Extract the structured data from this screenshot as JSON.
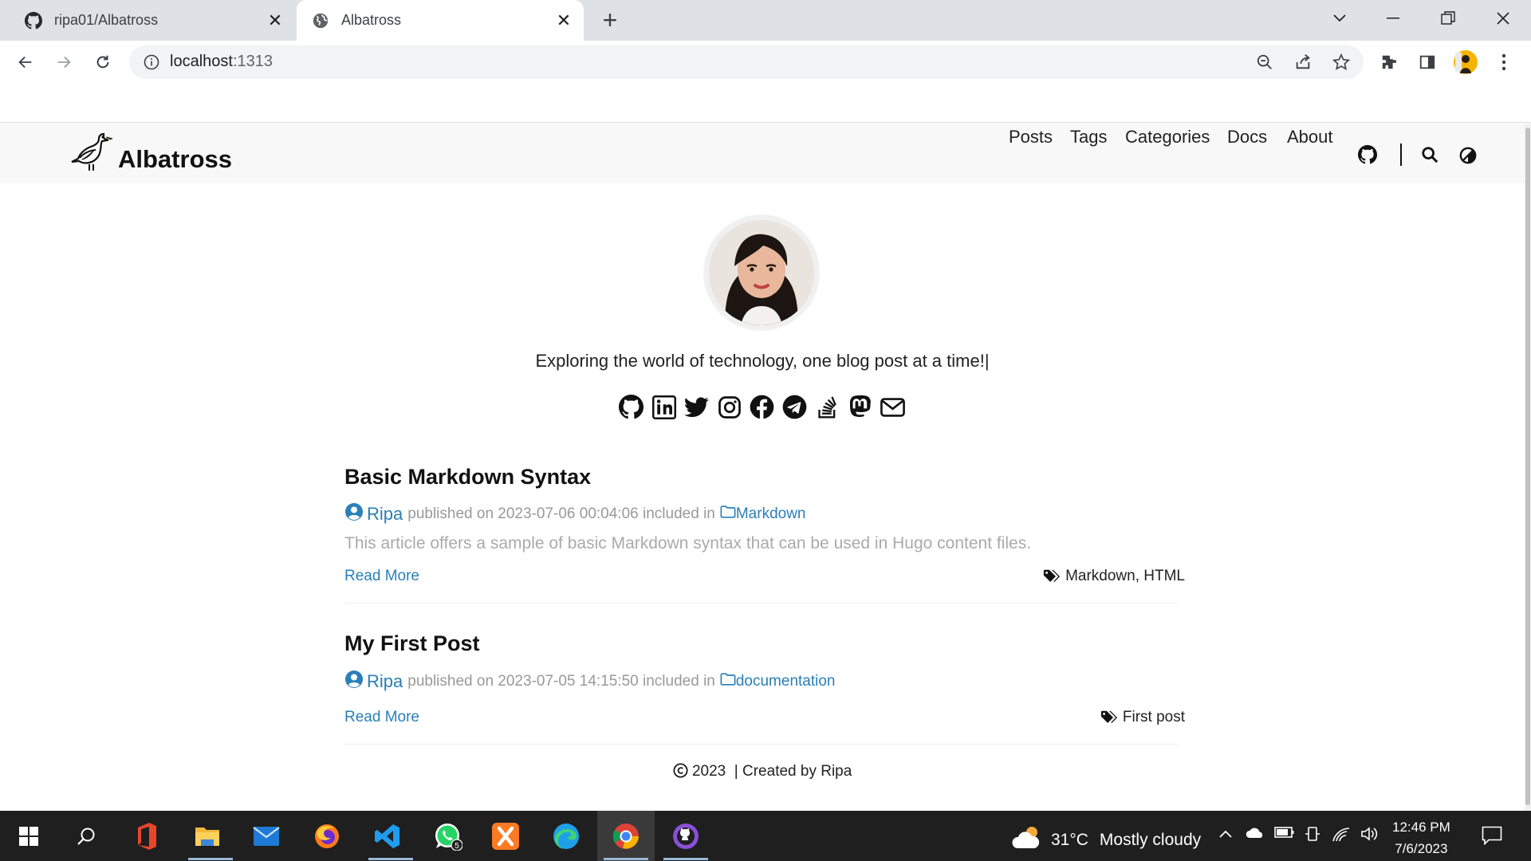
{
  "browser": {
    "tabs": [
      {
        "title": "ripa01/Albatross",
        "icon": "github-icon"
      },
      {
        "title": "Albatross",
        "icon": "globe-icon"
      }
    ],
    "address": {
      "host": "localhost",
      "port": ":1313"
    }
  },
  "site": {
    "brand": "Albatross",
    "nav": [
      "Posts",
      "Tags",
      "Categories",
      "Docs",
      "About"
    ],
    "tagline": "Exploring the world of technology, one blog post at a time!|",
    "socials": [
      "github-icon",
      "linkedin-icon",
      "twitter-icon",
      "instagram-icon",
      "facebook-icon",
      "telegram-icon",
      "stackoverflow-icon",
      "mastodon-icon",
      "email-icon"
    ],
    "posts": [
      {
        "title": "Basic Markdown Syntax",
        "author": "Ripa",
        "published_prefix": "published on",
        "date": "2023-07-06 00:04:06",
        "included": "included in",
        "category": "Markdown",
        "summary": "This article offers a sample of basic Markdown syntax that can be used in Hugo content files.",
        "read_more": "Read More",
        "tags": "Markdown, HTML"
      },
      {
        "title": "My First Post",
        "author": "Ripa",
        "published_prefix": "published on",
        "date": "2023-07-05 14:15:50",
        "included": "included in",
        "category": "documentation",
        "summary": "",
        "read_more": "Read More",
        "tags": "First post"
      }
    ],
    "footer": {
      "year": "2023",
      "credit": "| Created by Ripa"
    },
    "colors": {
      "link": "#2a7fb8",
      "header_bg": "#f8f8f8"
    }
  },
  "taskbar": {
    "apps": [
      "windows-start-icon",
      "search-icon",
      "office-icon",
      "file-explorer-icon",
      "mail-icon",
      "firefox-icon",
      "vscode-icon",
      "whatsapp-icon",
      "xampp-icon",
      "edge-icon",
      "chrome-icon",
      "github-desktop-icon"
    ],
    "whatsapp_badge": "5",
    "weather": {
      "temp": "31°C",
      "desc": "Mostly cloudy"
    },
    "time": "12:46 PM",
    "date": "7/6/2023"
  }
}
